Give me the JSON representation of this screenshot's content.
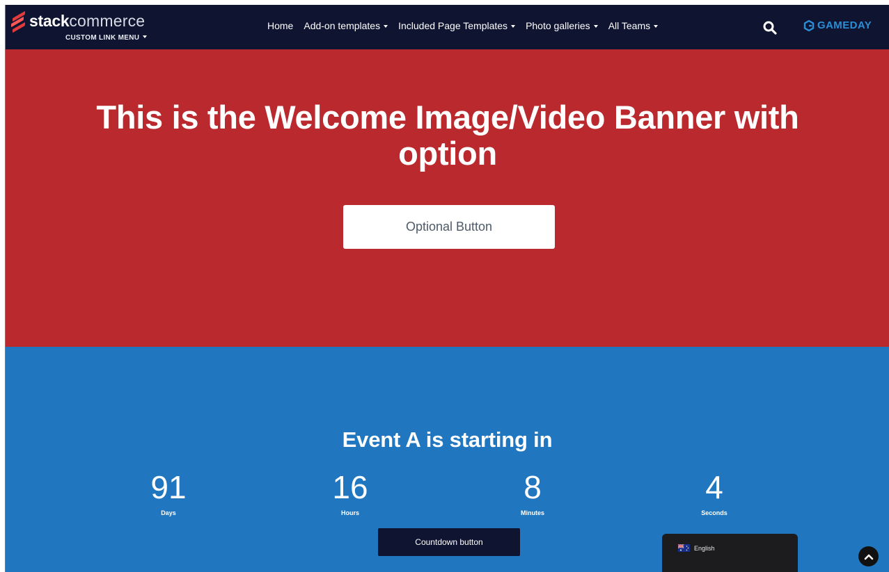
{
  "brand": {
    "name_bold": "stack",
    "name_light": "commerce",
    "sub_menu_label": "CUSTOM LINK MENU"
  },
  "nav": {
    "items": [
      {
        "label": "Home",
        "has_dropdown": false
      },
      {
        "label": "Add-on templates",
        "has_dropdown": true
      },
      {
        "label": "Included Page Templates",
        "has_dropdown": true
      },
      {
        "label": "Photo galleries",
        "has_dropdown": true
      },
      {
        "label": "All Teams",
        "has_dropdown": true
      }
    ],
    "search_icon": "search-icon",
    "partner_logo": "GAMEDAY"
  },
  "hero": {
    "title": "This is the Welcome Image/Video Banner with option",
    "button_label": "Optional Button",
    "background": "#b9292e"
  },
  "countdown": {
    "title": "Event A is starting in",
    "units": [
      {
        "value": "91",
        "label": "Days"
      },
      {
        "value": "16",
        "label": "Hours"
      },
      {
        "value": "8",
        "label": "Minutes"
      },
      {
        "value": "4",
        "label": "Seconds"
      }
    ],
    "button_label": "Countdown button",
    "background": "#2077c0"
  },
  "language": {
    "label": "English",
    "flag_icon": "australia-flag-icon"
  },
  "colors": {
    "nav_bg": "#0f1430",
    "accent_red": "#b9292e",
    "accent_blue": "#2077c0",
    "gameday_blue": "#2a8ed8"
  }
}
